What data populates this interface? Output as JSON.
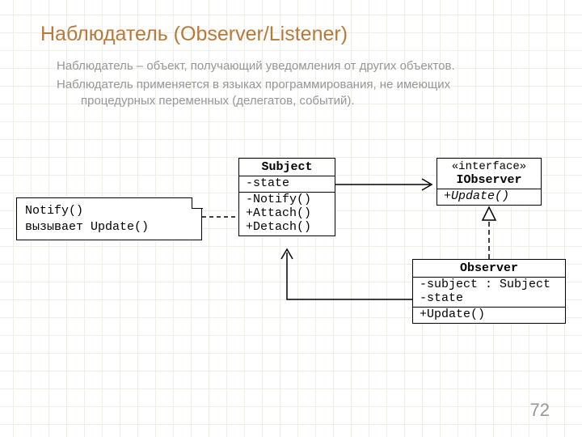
{
  "title": "Наблюдатель (Observer/Listener)",
  "para1": "Наблюдатель – объект, получающий уведомления от других объектов.",
  "para2a": "Наблюдатель применяется в языках программирования, не имеющих",
  "para2b": "процедурных переменных (делегатов, событий).",
  "note": {
    "line1": "Notify()",
    "line2": "вызывает Update()"
  },
  "subject": {
    "name": "Subject",
    "attrs": [
      "-state"
    ],
    "ops": [
      "-Notify()",
      "+Attach()",
      "+Detach()"
    ]
  },
  "iobserver": {
    "stereo": "«interface»",
    "name": "IObserver",
    "ops": [
      "+Update()"
    ]
  },
  "observer": {
    "name": "Observer",
    "attrs": [
      "-subject : Subject",
      "-state"
    ],
    "ops": [
      "+Update()"
    ]
  },
  "page": "72"
}
